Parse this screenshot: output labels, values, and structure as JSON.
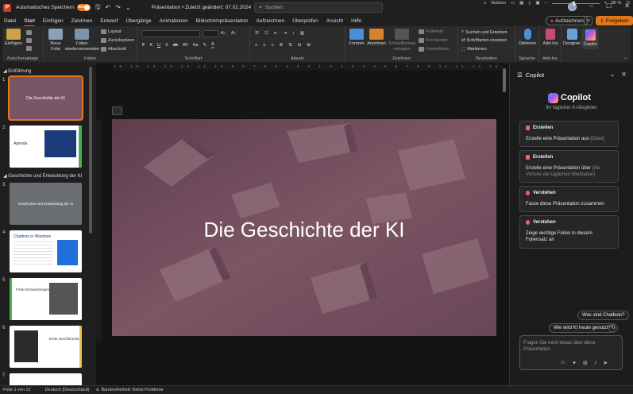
{
  "titlebar": {
    "autosave_label": "Automatisches Speichern",
    "autosave_state": "Ein",
    "doc_title": "Präsentation • Zuletzt geändert: 07.02.2024",
    "search_placeholder": "Suchen"
  },
  "menu": {
    "tabs": [
      "Datei",
      "Start",
      "Einfügen",
      "Zeichnen",
      "Entwurf",
      "Übergänge",
      "Animationen",
      "Bildschirmpräsentation",
      "Aufzeichnen",
      "Überprüfen",
      "Ansicht",
      "Hilfe"
    ],
    "active_tab": "Start",
    "record_label": "Aufzeichnen",
    "share_label": "Freigeben"
  },
  "ribbon": {
    "clipboard": {
      "paste": "Einfügen",
      "label": "Zwischenablage"
    },
    "slides": {
      "new_slide": "Neue Folie",
      "reuse_slides": "Folien wiederverwenden",
      "layout": "Layout",
      "reset": "Zurücksetzen",
      "section": "Abschnitt",
      "label": "Folien"
    },
    "font": {
      "label": "Schriftart"
    },
    "paragraph": {
      "label": "Absatz"
    },
    "drawing": {
      "shapes": "Formen",
      "arrange": "Anordnen",
      "quick_styles": "Schnellformat-vorlagen",
      "fill": "Fülleffekt",
      "outline": "Formkontur",
      "effects": "Formeffekte",
      "label": "Zeichnen"
    },
    "editing": {
      "find": "Suchen und Ersetzen",
      "replace_fonts": "Schriftarten ersetzen",
      "select": "Markieren",
      "label": "Bearbeiten"
    },
    "voice": {
      "dictate": "Diktieren",
      "label": "Sprache"
    },
    "addins": {
      "addins": "Add-Ins",
      "label": "Add-Ins"
    },
    "designer": "Designer",
    "copilot": "Copilot"
  },
  "slides_panel": {
    "sections": [
      "Einführung",
      "Geschichte und Entwicklung der KI"
    ],
    "thumbs": [
      {
        "num": "1",
        "title": "Die Geschichte der KI"
      },
      {
        "num": "2",
        "title": "Agenda"
      },
      {
        "num": "3",
        "title": "Geschichte und Entwicklung der KI"
      },
      {
        "num": "4",
        "title": "Chatbots in Windows"
      },
      {
        "num": "5",
        "title": "Frühe Entwicklungen"
      },
      {
        "num": "6",
        "title": "Erste Durchbrüche"
      },
      {
        "num": "7",
        "title": ""
      }
    ]
  },
  "slide": {
    "title": "Die Geschichte der KI"
  },
  "copilot": {
    "header": "Copilot",
    "title": "Copilot",
    "subtitle": "Ihr täglicher KI-Begleiter",
    "cards": [
      {
        "kind": "Erstellen",
        "text": "Erstelle eine Präsentation aus",
        "muted": "[Datei]"
      },
      {
        "kind": "Erstellen",
        "text": "Erstelle eine Präsentation über",
        "muted": "[die Vorteile der täglichen Meditation]"
      },
      {
        "kind": "Verstehen",
        "text": "Fasse diese Präsentation zusammen",
        "muted": ""
      },
      {
        "kind": "Verstehen",
        "text": "Zeige wichtige Folien in diesem Foliensatz an",
        "muted": ""
      }
    ],
    "suggestions": [
      "Was sind Chatbots?",
      "Wie wird KI heute genutzt?"
    ],
    "input_placeholder": "Fragen Sie mich etwas über diese Präsentation"
  },
  "statusbar": {
    "slide_info": "Folie 1 von 12",
    "language": "Deutsch (Deutschland)",
    "accessibility": "Barrierefreiheit: Keine Probleme",
    "notes": "Notizen",
    "zoom": "85 %"
  }
}
